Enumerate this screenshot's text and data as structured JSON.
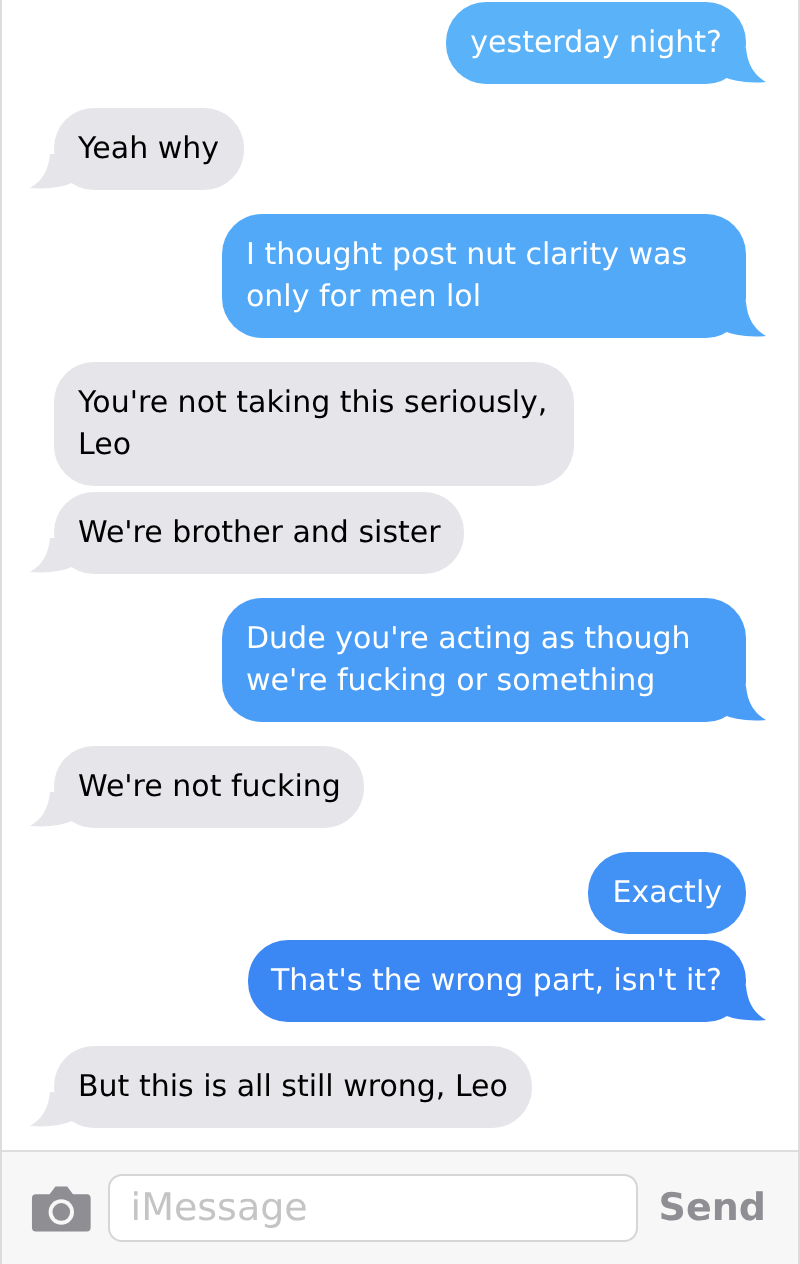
{
  "messages": [
    {
      "kind": "sent",
      "text": "yesterday night?",
      "color": "#5ab2f8",
      "tail": true
    },
    {
      "kind": "received",
      "text": "Yeah why",
      "tail": true
    },
    {
      "kind": "sent",
      "text": "I thought post nut clarity was only for men lol",
      "color": "#52a9f8",
      "tail": true
    },
    {
      "kind": "received",
      "text": "You're not taking this seriously, Leo",
      "tail": false
    },
    {
      "kind": "received",
      "text": "We're brother and sister",
      "tail": true
    },
    {
      "kind": "sent",
      "text": "Dude you're acting as though we're fucking or something",
      "color": "#4a9df6",
      "tail": true
    },
    {
      "kind": "received",
      "text": "We're not fucking",
      "tail": true
    },
    {
      "kind": "sent",
      "text": "Exactly",
      "color": "#4291f5",
      "tail": false
    },
    {
      "kind": "sent",
      "text": "That's the wrong part, isn't it?",
      "color": "#3b87f4",
      "tail": true
    },
    {
      "kind": "received",
      "text": "But this is all still wrong, Leo",
      "tail": true
    }
  ],
  "composer": {
    "placeholder": "iMessage",
    "send_label": "Send",
    "send_disabled": true
  }
}
